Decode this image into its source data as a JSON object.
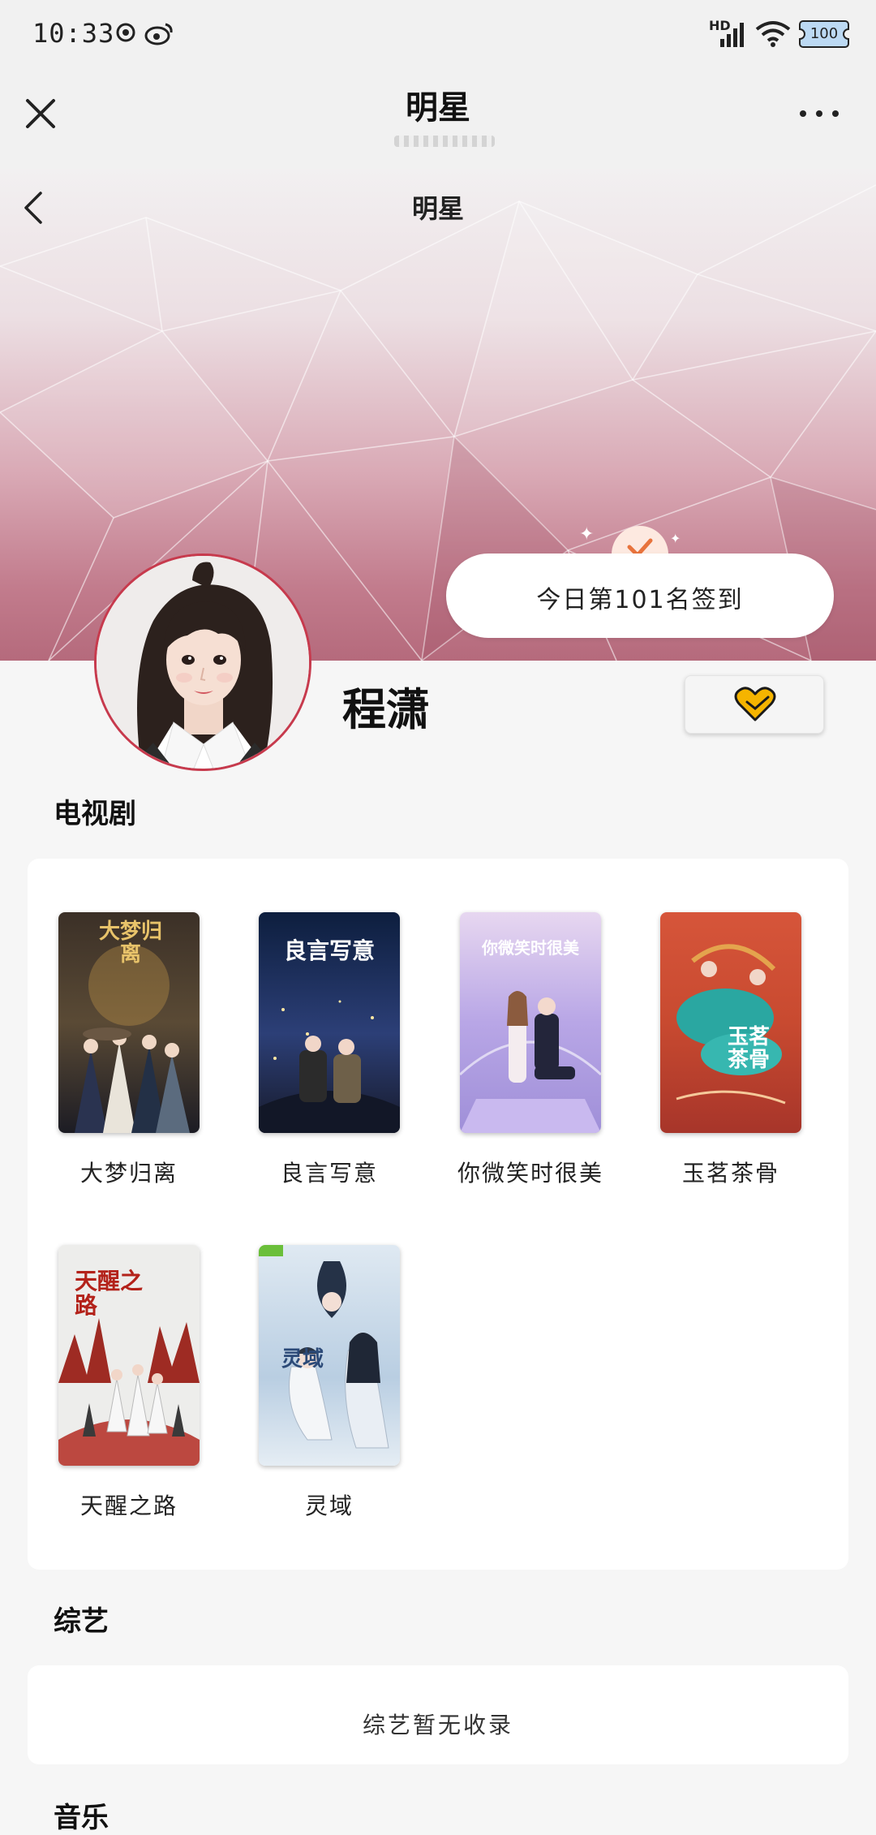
{
  "status_bar": {
    "time": "10:33",
    "battery": "100",
    "network": "HD"
  },
  "nav": {
    "title": "明星"
  },
  "hero": {
    "title": "明星",
    "checkin_text": "今日第101名签到"
  },
  "star": {
    "name": "程潇"
  },
  "sections": {
    "tv_title": "电视剧",
    "variety_title": "综艺",
    "variety_empty": "综艺暂无收录",
    "music_title": "音乐"
  },
  "dramas": [
    {
      "title": "大梦归离",
      "poster_text": "大梦归离"
    },
    {
      "title": "良言写意",
      "poster_text": "良言写意"
    },
    {
      "title": "你微笑时很美",
      "poster_text": "你微笑时很美"
    },
    {
      "title": "玉茗茶骨",
      "poster_text": "玉茗茶骨"
    },
    {
      "title": "天醒之路",
      "poster_text": "天醒之路"
    },
    {
      "title": "灵域",
      "poster_text": "灵域"
    }
  ],
  "colors": {
    "accent_red": "#c73a4d",
    "heart_yellow": "#f5b400",
    "check_orange": "#e8733c"
  }
}
